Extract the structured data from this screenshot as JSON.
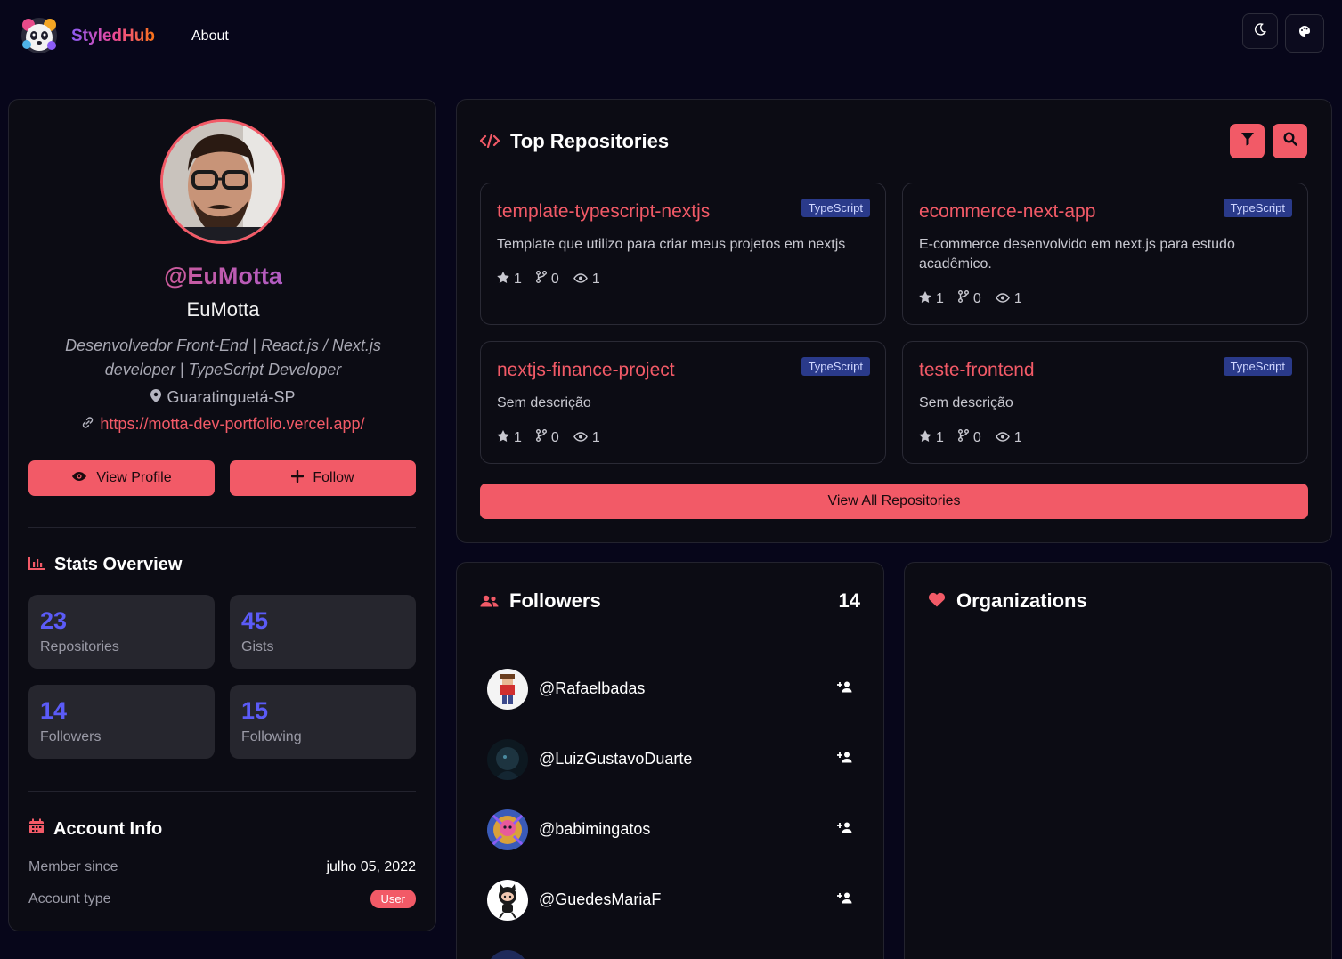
{
  "header": {
    "brand": "StyledHub",
    "nav_about": "About"
  },
  "profile": {
    "username": "@EuMotta",
    "name": "EuMotta",
    "bio": "Desenvolvedor Front-End | React.js / Next.js developer | TypeScript Developer",
    "location": "Guaratinguetá-SP",
    "website": "https://motta-dev-portfolio.vercel.app/",
    "view_profile_label": "View Profile",
    "follow_label": "Follow"
  },
  "stats": {
    "title": "Stats Overview",
    "items": [
      {
        "value": "23",
        "label": "Repositories"
      },
      {
        "value": "45",
        "label": "Gists"
      },
      {
        "value": "14",
        "label": "Followers"
      },
      {
        "value": "15",
        "label": "Following"
      }
    ]
  },
  "account": {
    "title": "Account Info",
    "member_since_label": "Member since",
    "member_since_value": "julho 05, 2022",
    "type_label": "Account type",
    "type_value": "User"
  },
  "repos": {
    "title": "Top Repositories",
    "view_all_label": "View All Repositories",
    "items": [
      {
        "name": "template-typescript-nextjs",
        "language": "TypeScript",
        "description": "Template que utilizo para criar meus projetos em nextjs",
        "stars": "1",
        "forks": "0",
        "watchers": "1"
      },
      {
        "name": "ecommerce-next-app",
        "language": "TypeScript",
        "description": "E-commerce desenvolvido em next.js para estudo acadêmico.",
        "stars": "1",
        "forks": "0",
        "watchers": "1"
      },
      {
        "name": "nextjs-finance-project",
        "language": "TypeScript",
        "description": "Sem descrição",
        "stars": "1",
        "forks": "0",
        "watchers": "1"
      },
      {
        "name": "teste-frontend",
        "language": "TypeScript",
        "description": "Sem descrição",
        "stars": "1",
        "forks": "0",
        "watchers": "1"
      }
    ]
  },
  "followers": {
    "title": "Followers",
    "count": "14",
    "items": [
      {
        "login": "@Rafaelbadas"
      },
      {
        "login": "@LuizGustavoDuarte"
      },
      {
        "login": "@babimingatos"
      },
      {
        "login": "@GuedesMariaF"
      }
    ]
  },
  "organizations": {
    "title": "Organizations"
  },
  "colors": {
    "accent": "#f25a67",
    "stat_number": "#5b5bf7",
    "language_badge": "#2a3a8a",
    "background": "#07061a"
  },
  "icons": [
    "logo-icon",
    "moon-icon",
    "palette-icon",
    "eye-icon",
    "plus-icon",
    "map-pin-icon",
    "link-icon",
    "bar-chart-icon",
    "calendar-icon",
    "code-icon",
    "filter-icon",
    "search-icon",
    "star-icon",
    "fork-icon",
    "users-icon",
    "user-plus-icon",
    "heart-icon"
  ]
}
